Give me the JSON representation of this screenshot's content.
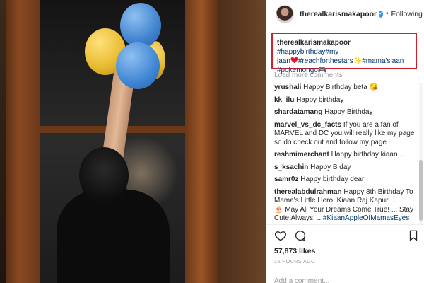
{
  "post": {
    "username": "therealkarismakapoor",
    "dot": "•",
    "follow_label": "Following",
    "verified_glyph": "✓"
  },
  "caption": {
    "username": "therealkarismakapoor",
    "tags_a": "#happybirthday#my",
    "tags_b": "jaan",
    "tags_c": "#reachforthestars",
    "tags_d": "#mama'sjaan",
    "tags_e": "#pokemongo",
    "sparkle_glyph": "✨",
    "gamepad_glyph": "🎮",
    "highlight_color": "#d0202a"
  },
  "load_more": "Load more comments",
  "comments": [
    {
      "user": "yrushali",
      "text": "Happy Birthday beta",
      "emoji": "😘"
    },
    {
      "user": "kk_ilu",
      "text": "Happy birthday",
      "emoji": ""
    },
    {
      "user": "shardatamang",
      "text": "Happy Birthday",
      "emoji": ""
    },
    {
      "user": "marvel_vs_dc_facts",
      "text": "If you are a fan of MARVEL and DC you will really like my page so do check out and follow my page",
      "emoji": ""
    },
    {
      "user": "reshmimerchant",
      "text": "Happy birthday kiaan...",
      "emoji": ""
    },
    {
      "user": "s_ksachin",
      "text": "Happy B day",
      "emoji": ""
    },
    {
      "user": "samr0z",
      "text": "Happy birthday dear",
      "emoji": ""
    },
    {
      "user": "therealabdulrahman",
      "text": "Happy 8th Birthday To Mama's Little Hero, Kiaan Raj Kapur ...",
      "emoji": ""
    }
  ],
  "last_comment_tail": {
    "cake": "🎂",
    "line2": "May All Your Dreams Come True! ... Stay Cute Always! .. ",
    "tag": "#KiaanAppleOfMamasEyes"
  },
  "likes": "57,873 likes",
  "time_ago": "16 HOURS AGO",
  "add_comment": "Add a comment...",
  "icons": [
    "verified-icon",
    "heart-icon",
    "comment-icon",
    "bookmark-icon",
    "heart-emoji-icon"
  ]
}
